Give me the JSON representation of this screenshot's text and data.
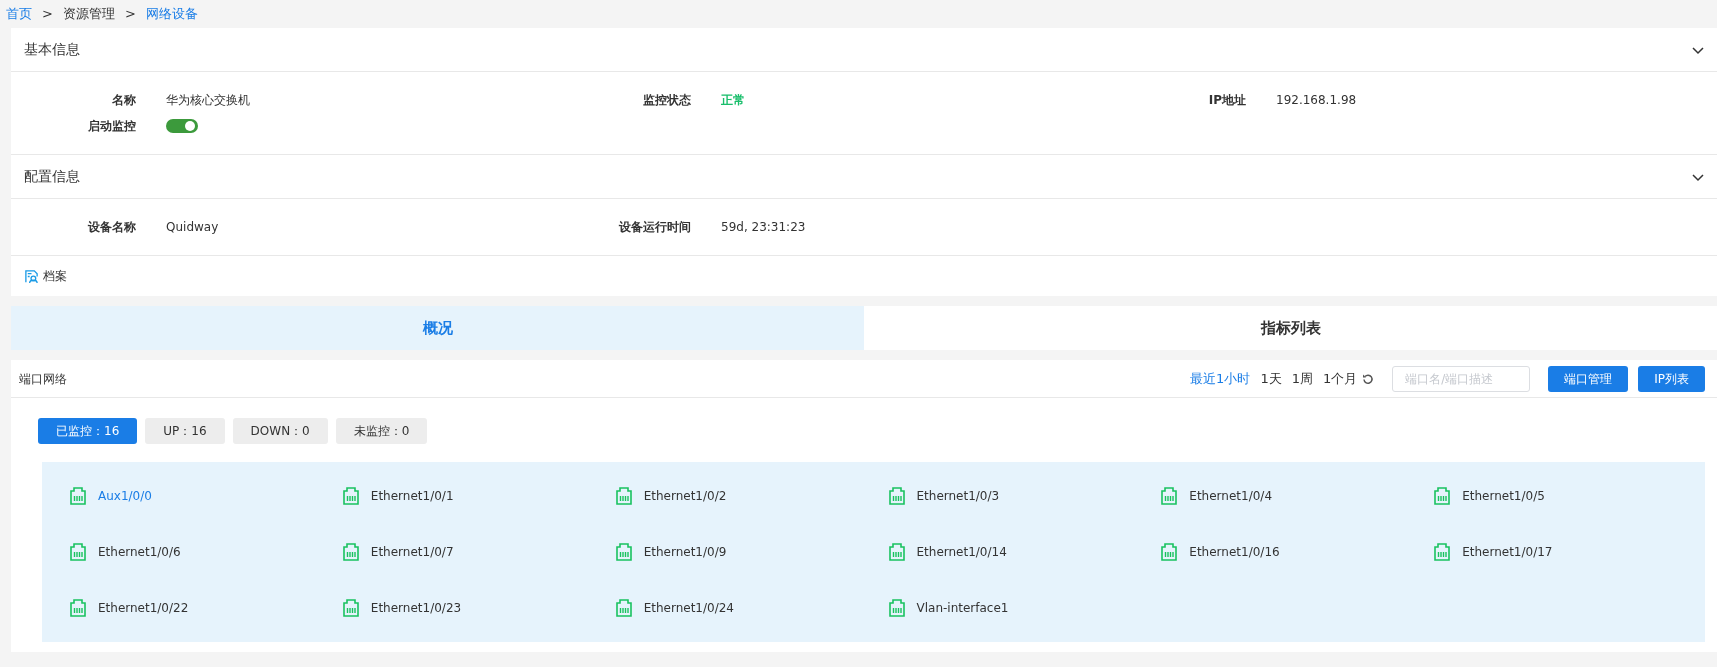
{
  "breadcrumb": [
    {
      "label": "首页",
      "kind": "link"
    },
    {
      "label": ">",
      "kind": "sep"
    },
    {
      "label": "资源管理",
      "kind": "text"
    },
    {
      "label": ">",
      "kind": "sep"
    },
    {
      "label": "网络设备",
      "kind": "current"
    }
  ],
  "basic_info": {
    "title": "基本信息",
    "expanded": true,
    "fields": [
      {
        "label": "名称",
        "value": "华为核心交换机",
        "kind": "text"
      },
      {
        "label": "监控状态",
        "value": "正常",
        "kind": "status"
      },
      {
        "label": "IP地址",
        "value": "192.168.1.98",
        "kind": "text"
      },
      {
        "label": "启动监控",
        "on": true,
        "kind": "switch"
      }
    ]
  },
  "config_info": {
    "title": "配置信息",
    "expanded": true,
    "fields": [
      {
        "label": "设备名称",
        "value": "Quidway",
        "kind": "text"
      },
      {
        "label": "设备运行时间",
        "value": "59d, 23:31:23",
        "kind": "text"
      }
    ]
  },
  "archive_link": "档案",
  "tabs": [
    {
      "label": "概况",
      "selected": true
    },
    {
      "label": "指标列表",
      "selected": false
    }
  ],
  "port_panel": {
    "title": "端口网络",
    "time_ranges": [
      {
        "label": "最近1小时",
        "selected": true
      },
      {
        "label": "1天",
        "selected": false
      },
      {
        "label": "1周",
        "selected": false
      },
      {
        "label": "1个月",
        "selected": false
      }
    ],
    "search": {
      "placeholder": "端口名/端口描述"
    },
    "buttons": [
      "端口管理",
      "IP列表"
    ],
    "filters": [
      {
        "label": "已监控：16",
        "selected": true
      },
      {
        "label": "UP：16",
        "selected": false
      },
      {
        "label": "DOWN：0",
        "selected": false
      },
      {
        "label": "未监控：0",
        "selected": false
      }
    ],
    "ports": [
      {
        "name": "Aux1/0/0",
        "selected": true
      },
      {
        "name": "Ethernet1/0/1",
        "selected": false
      },
      {
        "name": "Ethernet1/0/2",
        "selected": false
      },
      {
        "name": "Ethernet1/0/3",
        "selected": false
      },
      {
        "name": "Ethernet1/0/4",
        "selected": false
      },
      {
        "name": "Ethernet1/0/5",
        "selected": false
      },
      {
        "name": "Ethernet1/0/6",
        "selected": false
      },
      {
        "name": "Ethernet1/0/7",
        "selected": false
      },
      {
        "name": "Ethernet1/0/9",
        "selected": false
      },
      {
        "name": "Ethernet1/0/14",
        "selected": false
      },
      {
        "name": "Ethernet1/0/16",
        "selected": false
      },
      {
        "name": "Ethernet1/0/17",
        "selected": false
      },
      {
        "name": "Ethernet1/0/22",
        "selected": false
      },
      {
        "name": "Ethernet1/0/23",
        "selected": false
      },
      {
        "name": "Ethernet1/0/24",
        "selected": false
      },
      {
        "name": "Vlan-interface1",
        "selected": false
      }
    ]
  }
}
